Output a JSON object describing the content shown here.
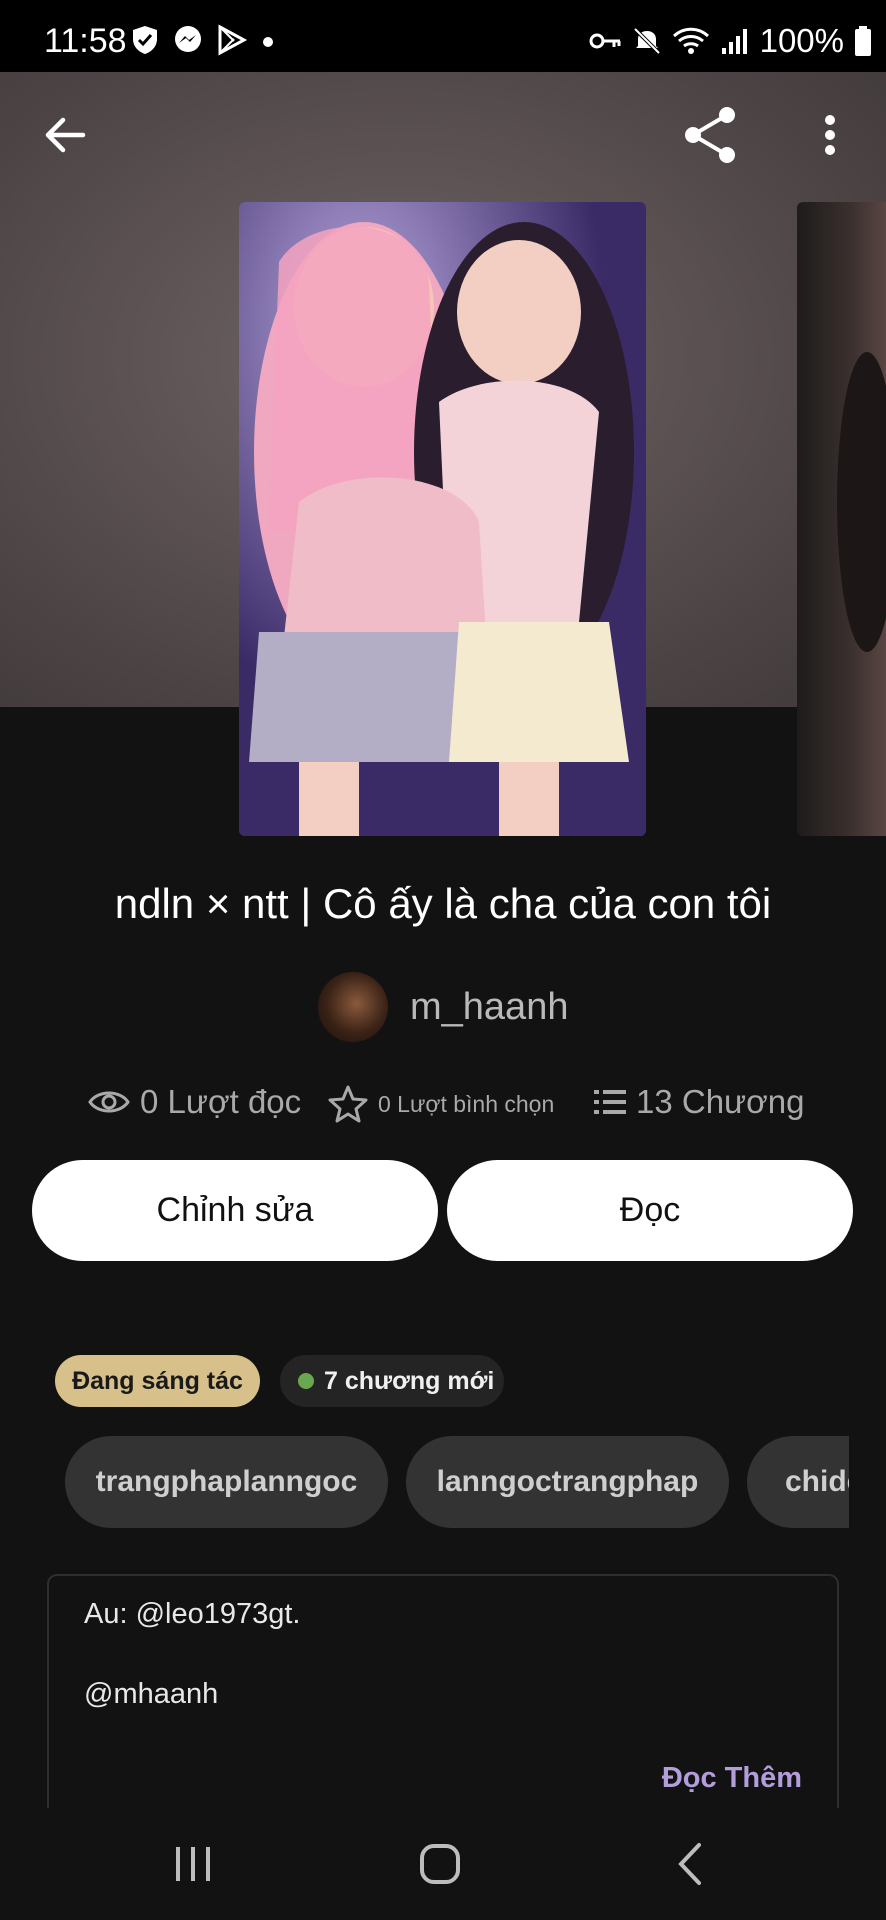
{
  "status_bar": {
    "time": "11:58",
    "left_icons": [
      "shield-icon",
      "messenger-icon",
      "play-store-icon",
      "dot-icon"
    ],
    "right_icons": [
      "key-icon",
      "mute-icon",
      "wifi-icon",
      "signal-icon",
      "battery-icon"
    ],
    "battery": "100%"
  },
  "toolbar": {
    "back": "arrow-back-icon",
    "share": "share-icon",
    "more": "more-vert-icon"
  },
  "story": {
    "title": "ndln × ntt | Cô ấy là cha của con tôi",
    "author": "m_haanh",
    "stats": {
      "reads": "0 Lượt đọc",
      "votes": "0 Lượt bình chọn",
      "chapters": "13 Chương"
    }
  },
  "actions": {
    "edit": "Chỉnh sửa",
    "read": "Đọc"
  },
  "badges": {
    "status": "Đang sáng tác",
    "new_chapters": "7 chương mới"
  },
  "tags": [
    "trangphaplanngoc",
    "lanngoctrangphap",
    "chide"
  ],
  "description": {
    "line1": "Au: @leo1973gt.",
    "line2": "@mhaanh",
    "read_more": "Đọc Thêm"
  },
  "colors": {
    "accent": "#b39ddb",
    "status_badge": "#d7c08a",
    "new_dot": "#6aa84f"
  }
}
